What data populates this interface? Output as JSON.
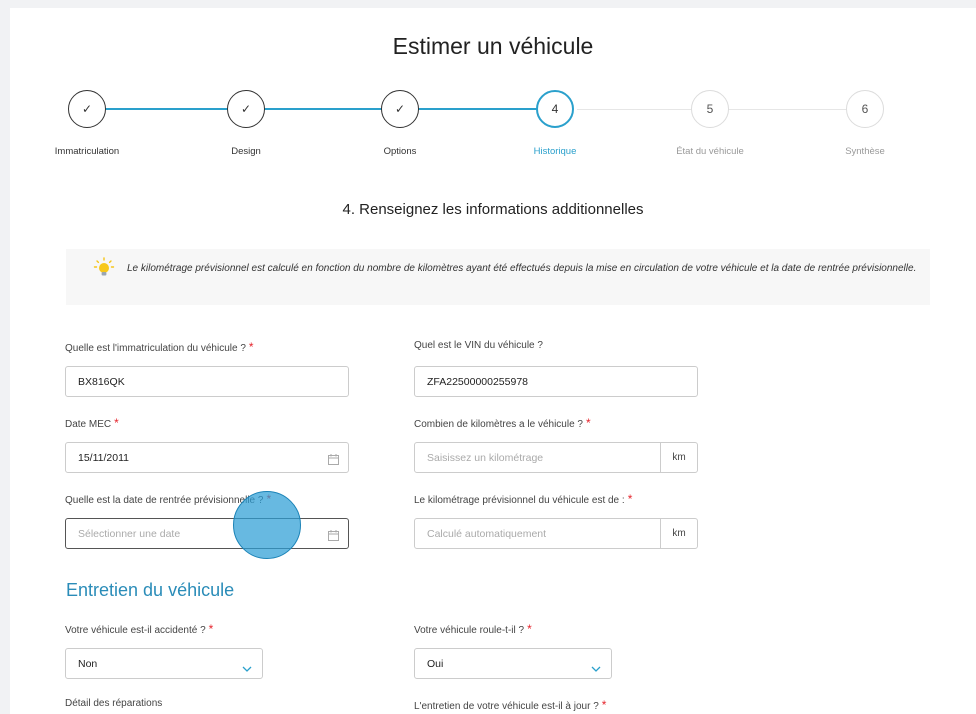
{
  "page": {
    "title": "Estimer un véhicule",
    "subtitle": "4. Renseignez les informations additionnelles"
  },
  "steps": [
    {
      "label": "Immatriculation",
      "state": "done",
      "mark": "✓"
    },
    {
      "label": "Design",
      "state": "done",
      "mark": "✓"
    },
    {
      "label": "Options",
      "state": "done",
      "mark": "✓"
    },
    {
      "label": "Historique",
      "state": "active",
      "mark": "4"
    },
    {
      "label": "État du véhicule",
      "state": "todo",
      "mark": "5"
    },
    {
      "label": "Synthèse",
      "state": "todo",
      "mark": "6"
    }
  ],
  "info": {
    "text": "Le kilométrage prévisionnel est calculé en fonction du nombre de kilomètres ayant été effectués depuis la mise en circulation de votre véhicule et la date de rentrée prévisionnelle.",
    "icon": "lightbulb-icon"
  },
  "form": {
    "immat": {
      "label": "Quelle est l'immatriculation du véhicule ?",
      "value": "BX816QK",
      "required": "*"
    },
    "vin": {
      "label": "Quel est le VIN du véhicule ?",
      "value": "ZFA22500000255978"
    },
    "date_mec": {
      "label": "Date MEC",
      "value": "15/11/2011",
      "required": "*"
    },
    "km": {
      "label": "Combien de kilomètres a le véhicule ?",
      "placeholder": "Saisissez un kilométrage",
      "unit": "km",
      "required": "*"
    },
    "date_rentree": {
      "label": "Quelle est la date de rentrée prévisionnelle ?",
      "placeholder": "Sélectionner une date",
      "required": "*"
    },
    "km_prev": {
      "label": "Le kilométrage prévisionnel du véhicule est de :",
      "placeholder": "Calculé automatiquement",
      "unit": "km",
      "required": "*"
    }
  },
  "entretien": {
    "title": "Entretien du véhicule",
    "accidente": {
      "label": "Votre véhicule est-il accidenté ?",
      "value": "Non",
      "required": "*"
    },
    "roule": {
      "label": "Votre véhicule roule-t-il ?",
      "value": "Oui",
      "required": "*"
    },
    "reparations": {
      "label": "Détail des réparations"
    },
    "a_jour": {
      "label": "L'entretien de votre véhicule est-il à jour ?",
      "required": "*"
    }
  },
  "colors": {
    "accent": "#2aa0cc",
    "required": "#e5242c",
    "section": "#2a8cb8"
  }
}
